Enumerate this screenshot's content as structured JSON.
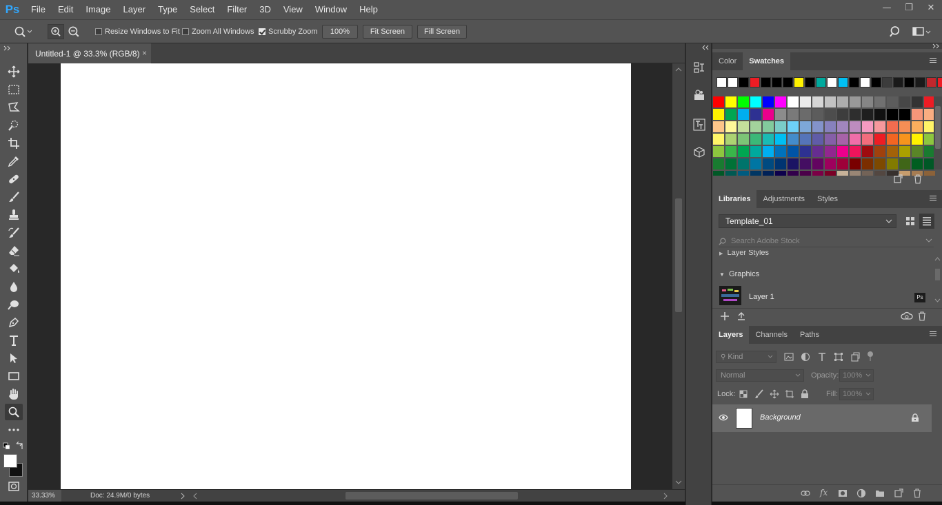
{
  "app": {
    "logo": "Ps"
  },
  "menu": [
    "File",
    "Edit",
    "Image",
    "Layer",
    "Type",
    "Select",
    "Filter",
    "3D",
    "View",
    "Window",
    "Help"
  ],
  "window_controls": {
    "minimize": "—",
    "restore": "❐",
    "close": "✕"
  },
  "options": {
    "resize_windows": "Resize Windows to Fit",
    "zoom_all": "Zoom All Windows",
    "scrubby_zoom": "Scrubby Zoom",
    "zoom_value": "100%",
    "fit_screen": "Fit Screen",
    "fill_screen": "Fill Screen"
  },
  "document": {
    "tab_title": "Untitled-1 @ 33.3% (RGB/8)",
    "close": "×",
    "zoom": "33.33%",
    "doc_info": "Doc: 24.9M/0 bytes"
  },
  "panels": {
    "color_tabs": [
      "Color",
      "Swatches"
    ],
    "active_color_tab": "Swatches",
    "libraries_tabs": [
      "Libraries",
      "Adjustments",
      "Styles"
    ],
    "library_name": "Template_01",
    "search_placeholder": "Search Adobe Stock",
    "library_sections": {
      "layer_styles": "Layer Styles",
      "graphics": "Graphics"
    },
    "library_item": "Layer 1",
    "library_item_badge": "Ps",
    "layers_tabs": [
      "Layers",
      "Channels",
      "Paths"
    ],
    "kind_label": "Kind",
    "blend_mode": "Normal",
    "opacity_label": "Opacity:",
    "opacity_value": "100%",
    "lock_label": "Lock:",
    "fill_label": "Fill:",
    "fill_value": "100%",
    "layer_name": "Background"
  },
  "swatches": {
    "recent": [
      "#ffffff",
      "#ffffff",
      "#000000",
      "#ed1c24",
      "#000000",
      "#000000",
      "#000000",
      "#fff200",
      "#000000",
      "#00a99d",
      "#ffffff",
      "#00bff3",
      "#000000",
      "#ffffff",
      "#000000",
      "#3c3c3c",
      "#1a1a1a",
      "#000000",
      "#1a1a1a",
      "#c1272d",
      "#ed1c24"
    ],
    "rows": [
      [
        "#ff0000",
        "#ffff00",
        "#00ff00",
        "#00ffff",
        "#0000ff",
        "#ff00ff",
        "#ffffff",
        "#ebebeb",
        "#d6d6d6",
        "#c2c2c2",
        "#adadad",
        "#999999",
        "#858585",
        "#707070",
        "#5c5c5c",
        "#474747",
        "#333333",
        "#ed1c24"
      ],
      [
        "#fff200",
        "#00a651",
        "#00aeef",
        "#2e3192",
        "#ec008c",
        "#8c8c8c",
        "#7a7a7a",
        "#6b6b6b",
        "#5c5c5c",
        "#4d4d4d",
        "#3d3d3d",
        "#2e2e2e",
        "#1f1f1f",
        "#111111",
        "#000000",
        "#000000",
        "#f69679",
        "#f9ad81"
      ],
      [
        "#fdc689",
        "#fff799",
        "#c4df9b",
        "#a3d39c",
        "#82ca9c",
        "#7accc8",
        "#6dcff6",
        "#7da7d8",
        "#8393ca",
        "#8781bd",
        "#a186be",
        "#bd8cbf",
        "#f49ac1",
        "#f5989d",
        "#f26c4f",
        "#f68e55",
        "#fbaf5d",
        "#fff467"
      ],
      [
        "#fff568",
        "#acd372",
        "#7cc576",
        "#3bb878",
        "#1abbb4",
        "#00bff3",
        "#438ccb",
        "#5574b9",
        "#605ca8",
        "#855fa8",
        "#a763a8",
        "#f06ea9",
        "#f26d7d",
        "#ed1c24",
        "#f26522",
        "#f7941d",
        "#fff200",
        "#8dc63f"
      ],
      [
        "#8dc63f",
        "#39b54a",
        "#00a651",
        "#00a99d",
        "#00aeef",
        "#0072bc",
        "#0054a6",
        "#2e3192",
        "#662d91",
        "#92278f",
        "#ec008c",
        "#ed145b",
        "#9e0b0f",
        "#a0410d",
        "#a36209",
        "#aba000",
        "#598527",
        "#197b30"
      ],
      [
        "#197b30",
        "#007236",
        "#00746b",
        "#0076a3",
        "#004a80",
        "#003471",
        "#1b1464",
        "#440e62",
        "#630460",
        "#9e005d",
        "#9e0039",
        "#790000",
        "#7b2e00",
        "#7d4900",
        "#827b00",
        "#406618",
        "#005e20",
        "#005826"
      ],
      [
        "#005826",
        "#005952",
        "#005b7f",
        "#003663",
        "#002157",
        "#0d004c",
        "#32004b",
        "#4b0049",
        "#7b0046",
        "#7a0026",
        "#c7b299",
        "#998675",
        "#736357",
        "#534741",
        "#37302d",
        "#c69c6d",
        "#a67c52",
        "#8c6239"
      ]
    ]
  }
}
